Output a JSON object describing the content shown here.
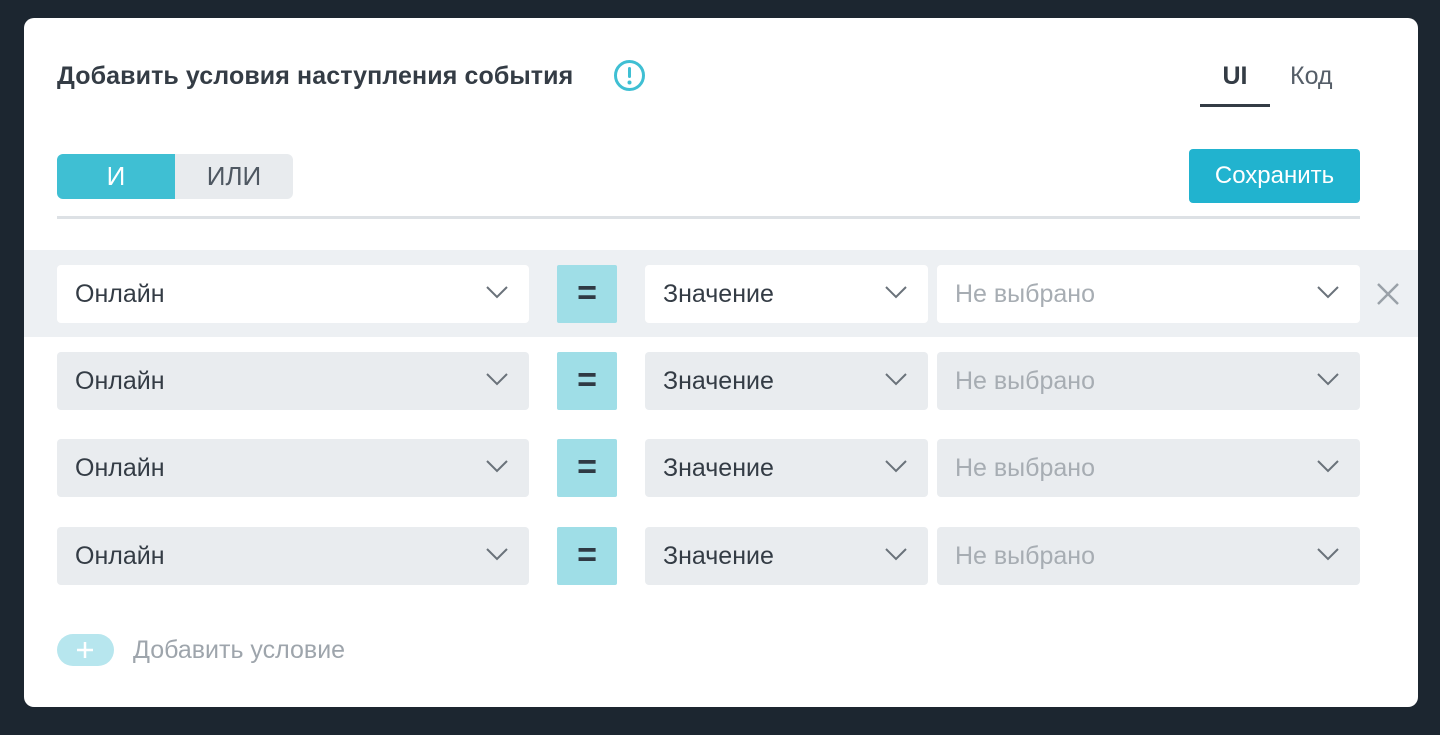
{
  "header": {
    "title": "Добавить условия наступления события",
    "info_icon": "exclamation-circle-icon",
    "tabs": [
      {
        "label": "UI",
        "active": true
      },
      {
        "label": "Код",
        "active": false
      }
    ]
  },
  "toolbar": {
    "logic": [
      {
        "label": "И",
        "active": true
      },
      {
        "label": "ИЛИ",
        "active": false
      }
    ],
    "save_label": "Сохранить"
  },
  "conditions": [
    {
      "field": "Онлайн",
      "operator": "=",
      "value_type": "Значение",
      "value": "Не выбрано"
    },
    {
      "field": "Онлайн",
      "operator": "=",
      "value_type": "Значение",
      "value": "Не выбрано"
    },
    {
      "field": "Онлайн",
      "operator": "=",
      "value_type": "Значение",
      "value": "Не выбрано"
    },
    {
      "field": "Онлайн",
      "operator": "=",
      "value_type": "Значение",
      "value": "Не выбрано"
    }
  ],
  "add_condition_label": "Добавить условие",
  "colors": {
    "accent": "#21b3cf",
    "toggle_active": "#3fbfd3",
    "operator_bg": "#9fdee7",
    "text": "#343c45",
    "placeholder": "#a7adb3"
  }
}
